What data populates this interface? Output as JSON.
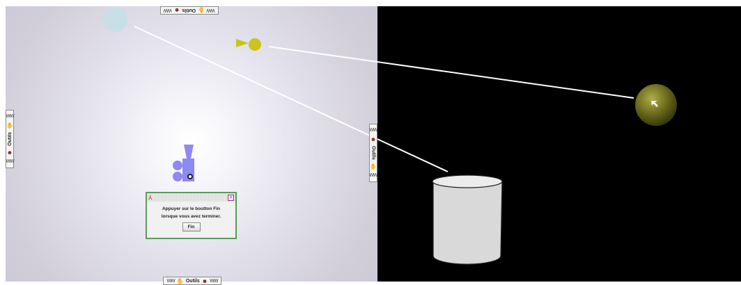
{
  "tool_tabs": {
    "label": "Outils",
    "zigzag": "WW",
    "hand_icon": "✋",
    "face_icon": "☻"
  },
  "dialog": {
    "app_icon": "⅄",
    "close_glyph": "×",
    "message_line1": "Appuyer sur le boutton Fin",
    "message_line2": "lorsque vous avez terminer.",
    "button_label": "Fin"
  },
  "colors": {
    "left_background": "#d1ceda",
    "right_background": "#000000",
    "cursor_blue": "#8f89f2",
    "yellow_pointer": "#c9c51b",
    "light_blue_circle": "#c7e0e8",
    "cylinder_fill": "#d9d9d9",
    "line": "#ffffff",
    "dialog_border": "#5a9a5a"
  }
}
